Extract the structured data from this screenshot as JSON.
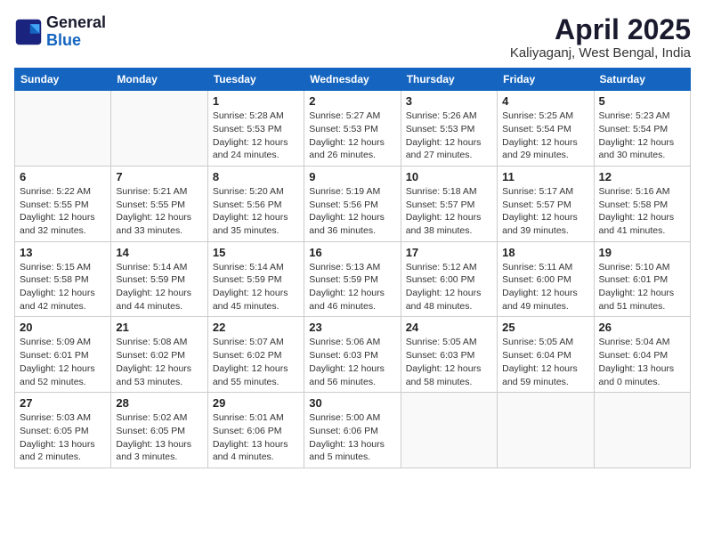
{
  "logo": {
    "line1": "General",
    "line2": "Blue"
  },
  "title": "April 2025",
  "location": "Kaliyaganj, West Bengal, India",
  "headers": [
    "Sunday",
    "Monday",
    "Tuesday",
    "Wednesday",
    "Thursday",
    "Friday",
    "Saturday"
  ],
  "weeks": [
    [
      {
        "day": "",
        "info": ""
      },
      {
        "day": "",
        "info": ""
      },
      {
        "day": "1",
        "info": "Sunrise: 5:28 AM\nSunset: 5:53 PM\nDaylight: 12 hours\nand 24 minutes."
      },
      {
        "day": "2",
        "info": "Sunrise: 5:27 AM\nSunset: 5:53 PM\nDaylight: 12 hours\nand 26 minutes."
      },
      {
        "day": "3",
        "info": "Sunrise: 5:26 AM\nSunset: 5:53 PM\nDaylight: 12 hours\nand 27 minutes."
      },
      {
        "day": "4",
        "info": "Sunrise: 5:25 AM\nSunset: 5:54 PM\nDaylight: 12 hours\nand 29 minutes."
      },
      {
        "day": "5",
        "info": "Sunrise: 5:23 AM\nSunset: 5:54 PM\nDaylight: 12 hours\nand 30 minutes."
      }
    ],
    [
      {
        "day": "6",
        "info": "Sunrise: 5:22 AM\nSunset: 5:55 PM\nDaylight: 12 hours\nand 32 minutes."
      },
      {
        "day": "7",
        "info": "Sunrise: 5:21 AM\nSunset: 5:55 PM\nDaylight: 12 hours\nand 33 minutes."
      },
      {
        "day": "8",
        "info": "Sunrise: 5:20 AM\nSunset: 5:56 PM\nDaylight: 12 hours\nand 35 minutes."
      },
      {
        "day": "9",
        "info": "Sunrise: 5:19 AM\nSunset: 5:56 PM\nDaylight: 12 hours\nand 36 minutes."
      },
      {
        "day": "10",
        "info": "Sunrise: 5:18 AM\nSunset: 5:57 PM\nDaylight: 12 hours\nand 38 minutes."
      },
      {
        "day": "11",
        "info": "Sunrise: 5:17 AM\nSunset: 5:57 PM\nDaylight: 12 hours\nand 39 minutes."
      },
      {
        "day": "12",
        "info": "Sunrise: 5:16 AM\nSunset: 5:58 PM\nDaylight: 12 hours\nand 41 minutes."
      }
    ],
    [
      {
        "day": "13",
        "info": "Sunrise: 5:15 AM\nSunset: 5:58 PM\nDaylight: 12 hours\nand 42 minutes."
      },
      {
        "day": "14",
        "info": "Sunrise: 5:14 AM\nSunset: 5:59 PM\nDaylight: 12 hours\nand 44 minutes."
      },
      {
        "day": "15",
        "info": "Sunrise: 5:14 AM\nSunset: 5:59 PM\nDaylight: 12 hours\nand 45 minutes."
      },
      {
        "day": "16",
        "info": "Sunrise: 5:13 AM\nSunset: 5:59 PM\nDaylight: 12 hours\nand 46 minutes."
      },
      {
        "day": "17",
        "info": "Sunrise: 5:12 AM\nSunset: 6:00 PM\nDaylight: 12 hours\nand 48 minutes."
      },
      {
        "day": "18",
        "info": "Sunrise: 5:11 AM\nSunset: 6:00 PM\nDaylight: 12 hours\nand 49 minutes."
      },
      {
        "day": "19",
        "info": "Sunrise: 5:10 AM\nSunset: 6:01 PM\nDaylight: 12 hours\nand 51 minutes."
      }
    ],
    [
      {
        "day": "20",
        "info": "Sunrise: 5:09 AM\nSunset: 6:01 PM\nDaylight: 12 hours\nand 52 minutes."
      },
      {
        "day": "21",
        "info": "Sunrise: 5:08 AM\nSunset: 6:02 PM\nDaylight: 12 hours\nand 53 minutes."
      },
      {
        "day": "22",
        "info": "Sunrise: 5:07 AM\nSunset: 6:02 PM\nDaylight: 12 hours\nand 55 minutes."
      },
      {
        "day": "23",
        "info": "Sunrise: 5:06 AM\nSunset: 6:03 PM\nDaylight: 12 hours\nand 56 minutes."
      },
      {
        "day": "24",
        "info": "Sunrise: 5:05 AM\nSunset: 6:03 PM\nDaylight: 12 hours\nand 58 minutes."
      },
      {
        "day": "25",
        "info": "Sunrise: 5:05 AM\nSunset: 6:04 PM\nDaylight: 12 hours\nand 59 minutes."
      },
      {
        "day": "26",
        "info": "Sunrise: 5:04 AM\nSunset: 6:04 PM\nDaylight: 13 hours\nand 0 minutes."
      }
    ],
    [
      {
        "day": "27",
        "info": "Sunrise: 5:03 AM\nSunset: 6:05 PM\nDaylight: 13 hours\nand 2 minutes."
      },
      {
        "day": "28",
        "info": "Sunrise: 5:02 AM\nSunset: 6:05 PM\nDaylight: 13 hours\nand 3 minutes."
      },
      {
        "day": "29",
        "info": "Sunrise: 5:01 AM\nSunset: 6:06 PM\nDaylight: 13 hours\nand 4 minutes."
      },
      {
        "day": "30",
        "info": "Sunrise: 5:00 AM\nSunset: 6:06 PM\nDaylight: 13 hours\nand 5 minutes."
      },
      {
        "day": "",
        "info": ""
      },
      {
        "day": "",
        "info": ""
      },
      {
        "day": "",
        "info": ""
      }
    ]
  ]
}
